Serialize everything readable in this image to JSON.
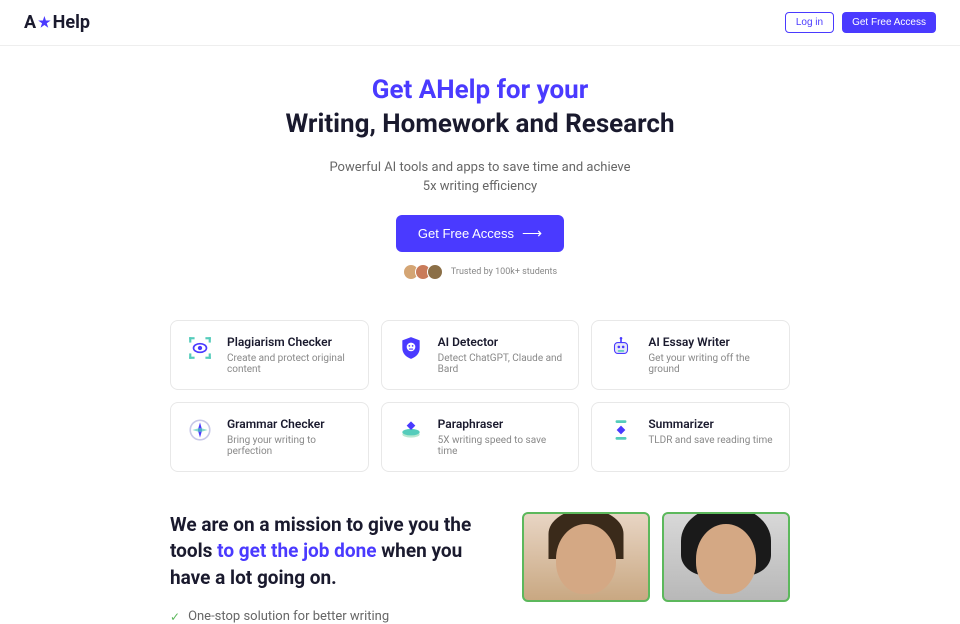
{
  "header": {
    "logo_prefix": "A",
    "logo_suffix": "Help",
    "login": "Log in",
    "get_access": "Get Free Access"
  },
  "hero": {
    "title_line1": "Get AHelp for your",
    "title_line2": "Writing, Homework and Research",
    "sub_line1": "Powerful AI tools and apps to save time and achieve",
    "sub_line2": "5x writing efficiency",
    "cta": "Get Free Access",
    "trust": "Trusted by 100k+ students"
  },
  "tools": [
    {
      "title": "Plagiarism Checker",
      "desc": "Create and protect original content"
    },
    {
      "title": "AI Detector",
      "desc": "Detect ChatGPT, Claude and Bard"
    },
    {
      "title": "AI Essay Writer",
      "desc": "Get your writing off the ground"
    },
    {
      "title": "Grammar Checker",
      "desc": "Bring your writing to perfection"
    },
    {
      "title": "Paraphraser",
      "desc": "5X writing speed to save time"
    },
    {
      "title": "Summarizer",
      "desc": "TLDR and save reading time"
    }
  ],
  "mission": {
    "text_1": "We are on a mission to give you the tools ",
    "text_2": "to get the job done",
    "text_3": " when you have a lot going on.",
    "item1": "One-stop solution for better writing"
  }
}
